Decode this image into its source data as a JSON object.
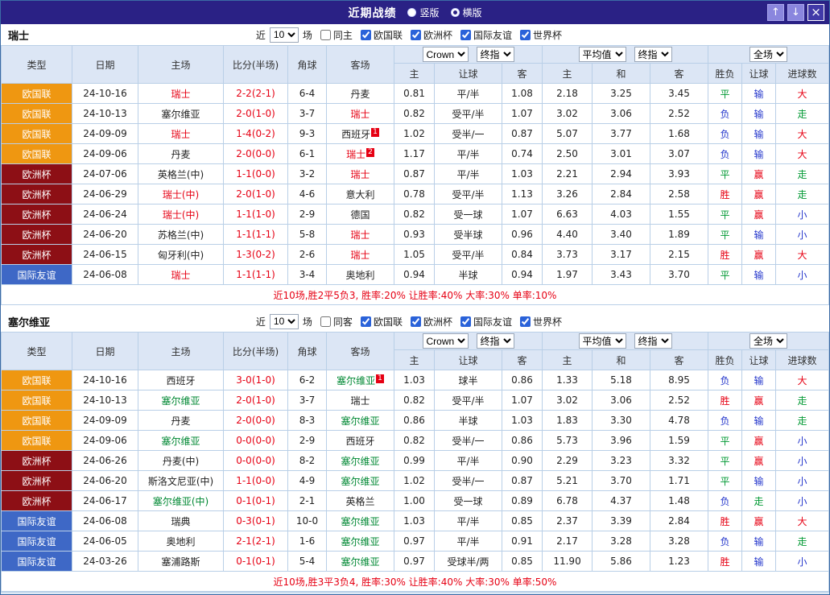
{
  "palette": {
    "titlebar_bg": "#2a2185",
    "type_bg": {
      "欧国联": "#ef9711",
      "欧洲杯": "#8d0f15",
      "国际友谊": "#3e68c6"
    },
    "result": {
      "red": "#e60013",
      "green": "#009933",
      "blue": "#2335cb"
    },
    "team": {
      "red": "#e60013",
      "green": "#008833",
      "black": "#222222"
    },
    "score": "#e60013"
  },
  "titlebar": {
    "title": "近期战绩",
    "radios": [
      {
        "label": "竖版",
        "selected": false
      },
      {
        "label": "横版",
        "selected": true
      }
    ],
    "buttons": [
      {
        "name": "scroll-up",
        "glyph": "↑"
      },
      {
        "name": "scroll-down",
        "glyph": "↓"
      },
      {
        "name": "close",
        "glyph": "×"
      }
    ]
  },
  "filter": {
    "recent_prefix": "近",
    "recent_value": "10",
    "recent_suffix": "场",
    "leagues": [
      {
        "label": "欧国联",
        "checked": true
      },
      {
        "label": "欧洲杯",
        "checked": true
      },
      {
        "label": "国际友谊",
        "checked": true
      },
      {
        "label": "世界杯",
        "checked": true
      }
    ]
  },
  "table": {
    "columns": [
      "类型",
      "日期",
      "主场",
      "比分(半场)",
      "角球",
      "客场",
      "主",
      "让球",
      "客",
      "主",
      "和",
      "客",
      "胜负",
      "让球",
      "进球数"
    ],
    "selects": {
      "odds_source": "Crown",
      "odds_stage": "终指",
      "avg_source": "平均值",
      "avg_stage": "终指",
      "scope": "全场"
    }
  },
  "sections": [
    {
      "team": "瑞士",
      "same_side_label": "同主",
      "same_side_checked": false,
      "summary": "近10场,胜2平5负3, 胜率:20% 让胜率:40% 大率:30% 单率:10%",
      "rows": [
        {
          "type": "欧国联",
          "date": "24-10-16",
          "home": {
            "name": "瑞士",
            "color": "red"
          },
          "score": "2-2(2-1)",
          "corner": "6-4",
          "away": {
            "name": "丹麦",
            "color": "black"
          },
          "odds": [
            "0.81",
            "平/半",
            "1.08"
          ],
          "avg": [
            "2.18",
            "3.25",
            "3.45"
          ],
          "results": [
            {
              "text": "平",
              "color": "green"
            },
            {
              "text": "输",
              "color": "blue"
            },
            {
              "text": "大",
              "color": "red"
            }
          ]
        },
        {
          "type": "欧国联",
          "date": "24-10-13",
          "home": {
            "name": "塞尔维亚",
            "color": "black"
          },
          "score": "2-0(1-0)",
          "corner": "3-7",
          "away": {
            "name": "瑞士",
            "color": "red"
          },
          "odds": [
            "0.82",
            "受平/半",
            "1.07"
          ],
          "avg": [
            "3.02",
            "3.06",
            "2.52"
          ],
          "results": [
            {
              "text": "负",
              "color": "blue"
            },
            {
              "text": "输",
              "color": "blue"
            },
            {
              "text": "走",
              "color": "green"
            }
          ]
        },
        {
          "type": "欧国联",
          "date": "24-09-09",
          "home": {
            "name": "瑞士",
            "color": "red"
          },
          "score": "1-4(0-2)",
          "corner": "9-3",
          "away": {
            "name": "西班牙",
            "color": "black",
            "badge": "1"
          },
          "odds": [
            "1.02",
            "受半/一",
            "0.87"
          ],
          "avg": [
            "5.07",
            "3.77",
            "1.68"
          ],
          "results": [
            {
              "text": "负",
              "color": "blue"
            },
            {
              "text": "输",
              "color": "blue"
            },
            {
              "text": "大",
              "color": "red"
            }
          ]
        },
        {
          "type": "欧国联",
          "date": "24-09-06",
          "home": {
            "name": "丹麦",
            "color": "black"
          },
          "score": "2-0(0-0)",
          "corner": "6-1",
          "away": {
            "name": "瑞士",
            "color": "red",
            "badge": "2"
          },
          "odds": [
            "1.17",
            "平/半",
            "0.74"
          ],
          "avg": [
            "2.50",
            "3.01",
            "3.07"
          ],
          "results": [
            {
              "text": "负",
              "color": "blue"
            },
            {
              "text": "输",
              "color": "blue"
            },
            {
              "text": "大",
              "color": "red"
            }
          ]
        },
        {
          "type": "欧洲杯",
          "date": "24-07-06",
          "home": {
            "name": "英格兰(中)",
            "color": "black"
          },
          "score": "1-1(0-0)",
          "corner": "3-2",
          "away": {
            "name": "瑞士",
            "color": "red"
          },
          "odds": [
            "0.87",
            "平/半",
            "1.03"
          ],
          "avg": [
            "2.21",
            "2.94",
            "3.93"
          ],
          "results": [
            {
              "text": "平",
              "color": "green"
            },
            {
              "text": "赢",
              "color": "red"
            },
            {
              "text": "走",
              "color": "green"
            }
          ]
        },
        {
          "type": "欧洲杯",
          "date": "24-06-29",
          "home": {
            "name": "瑞士(中)",
            "color": "red"
          },
          "score": "2-0(1-0)",
          "corner": "4-6",
          "away": {
            "name": "意大利",
            "color": "black"
          },
          "odds": [
            "0.78",
            "受平/半",
            "1.13"
          ],
          "avg": [
            "3.26",
            "2.84",
            "2.58"
          ],
          "results": [
            {
              "text": "胜",
              "color": "red"
            },
            {
              "text": "赢",
              "color": "red"
            },
            {
              "text": "走",
              "color": "green"
            }
          ]
        },
        {
          "type": "欧洲杯",
          "date": "24-06-24",
          "home": {
            "name": "瑞士(中)",
            "color": "red"
          },
          "score": "1-1(1-0)",
          "corner": "2-9",
          "away": {
            "name": "德国",
            "color": "black"
          },
          "odds": [
            "0.82",
            "受一球",
            "1.07"
          ],
          "avg": [
            "6.63",
            "4.03",
            "1.55"
          ],
          "results": [
            {
              "text": "平",
              "color": "green"
            },
            {
              "text": "赢",
              "color": "red"
            },
            {
              "text": "小",
              "color": "blue"
            }
          ]
        },
        {
          "type": "欧洲杯",
          "date": "24-06-20",
          "home": {
            "name": "苏格兰(中)",
            "color": "black"
          },
          "score": "1-1(1-1)",
          "corner": "5-8",
          "away": {
            "name": "瑞士",
            "color": "red"
          },
          "odds": [
            "0.93",
            "受半球",
            "0.96"
          ],
          "avg": [
            "4.40",
            "3.40",
            "1.89"
          ],
          "results": [
            {
              "text": "平",
              "color": "green"
            },
            {
              "text": "输",
              "color": "blue"
            },
            {
              "text": "小",
              "color": "blue"
            }
          ]
        },
        {
          "type": "欧洲杯",
          "date": "24-06-15",
          "home": {
            "name": "匈牙利(中)",
            "color": "black"
          },
          "score": "1-3(0-2)",
          "corner": "2-6",
          "away": {
            "name": "瑞士",
            "color": "red"
          },
          "odds": [
            "1.05",
            "受平/半",
            "0.84"
          ],
          "avg": [
            "3.73",
            "3.17",
            "2.15"
          ],
          "results": [
            {
              "text": "胜",
              "color": "red"
            },
            {
              "text": "赢",
              "color": "red"
            },
            {
              "text": "大",
              "color": "red"
            }
          ]
        },
        {
          "type": "国际友谊",
          "date": "24-06-08",
          "home": {
            "name": "瑞士",
            "color": "red"
          },
          "score": "1-1(1-1)",
          "corner": "3-4",
          "away": {
            "name": "奥地利",
            "color": "black"
          },
          "odds": [
            "0.94",
            "半球",
            "0.94"
          ],
          "avg": [
            "1.97",
            "3.43",
            "3.70"
          ],
          "results": [
            {
              "text": "平",
              "color": "green"
            },
            {
              "text": "输",
              "color": "blue"
            },
            {
              "text": "小",
              "color": "blue"
            }
          ]
        }
      ]
    },
    {
      "team": "塞尔维亚",
      "same_side_label": "同客",
      "same_side_checked": false,
      "summary": "近10场,胜3平3负4, 胜率:30% 让胜率:40% 大率:30% 单率:50%",
      "rows": [
        {
          "type": "欧国联",
          "date": "24-10-16",
          "home": {
            "name": "西班牙",
            "color": "black"
          },
          "score": "3-0(1-0)",
          "corner": "6-2",
          "away": {
            "name": "塞尔维亚",
            "color": "green",
            "badge": "1"
          },
          "odds": [
            "1.03",
            "球半",
            "0.86"
          ],
          "avg": [
            "1.33",
            "5.18",
            "8.95"
          ],
          "results": [
            {
              "text": "负",
              "color": "blue"
            },
            {
              "text": "输",
              "color": "blue"
            },
            {
              "text": "大",
              "color": "red"
            }
          ]
        },
        {
          "type": "欧国联",
          "date": "24-10-13",
          "home": {
            "name": "塞尔维亚",
            "color": "green"
          },
          "score": "2-0(1-0)",
          "corner": "3-7",
          "away": {
            "name": "瑞士",
            "color": "black"
          },
          "odds": [
            "0.82",
            "受平/半",
            "1.07"
          ],
          "avg": [
            "3.02",
            "3.06",
            "2.52"
          ],
          "results": [
            {
              "text": "胜",
              "color": "red"
            },
            {
              "text": "赢",
              "color": "red"
            },
            {
              "text": "走",
              "color": "green"
            }
          ]
        },
        {
          "type": "欧国联",
          "date": "24-09-09",
          "home": {
            "name": "丹麦",
            "color": "black"
          },
          "score": "2-0(0-0)",
          "corner": "8-3",
          "away": {
            "name": "塞尔维亚",
            "color": "green"
          },
          "odds": [
            "0.86",
            "半球",
            "1.03"
          ],
          "avg": [
            "1.83",
            "3.30",
            "4.78"
          ],
          "results": [
            {
              "text": "负",
              "color": "blue"
            },
            {
              "text": "输",
              "color": "blue"
            },
            {
              "text": "走",
              "color": "green"
            }
          ]
        },
        {
          "type": "欧国联",
          "date": "24-09-06",
          "home": {
            "name": "塞尔维亚",
            "color": "green"
          },
          "score": "0-0(0-0)",
          "corner": "2-9",
          "away": {
            "name": "西班牙",
            "color": "black"
          },
          "odds": [
            "0.82",
            "受半/一",
            "0.86"
          ],
          "avg": [
            "5.73",
            "3.96",
            "1.59"
          ],
          "results": [
            {
              "text": "平",
              "color": "green"
            },
            {
              "text": "赢",
              "color": "red"
            },
            {
              "text": "小",
              "color": "blue"
            }
          ]
        },
        {
          "type": "欧洲杯",
          "date": "24-06-26",
          "home": {
            "name": "丹麦(中)",
            "color": "black"
          },
          "score": "0-0(0-0)",
          "corner": "8-2",
          "away": {
            "name": "塞尔维亚",
            "color": "green"
          },
          "odds": [
            "0.99",
            "平/半",
            "0.90"
          ],
          "avg": [
            "2.29",
            "3.23",
            "3.32"
          ],
          "results": [
            {
              "text": "平",
              "color": "green"
            },
            {
              "text": "赢",
              "color": "red"
            },
            {
              "text": "小",
              "color": "blue"
            }
          ]
        },
        {
          "type": "欧洲杯",
          "date": "24-06-20",
          "home": {
            "name": "斯洛文尼亚(中)",
            "color": "black"
          },
          "score": "1-1(0-0)",
          "corner": "4-9",
          "away": {
            "name": "塞尔维亚",
            "color": "green"
          },
          "odds": [
            "1.02",
            "受半/一",
            "0.87"
          ],
          "avg": [
            "5.21",
            "3.70",
            "1.71"
          ],
          "results": [
            {
              "text": "平",
              "color": "green"
            },
            {
              "text": "输",
              "color": "blue"
            },
            {
              "text": "小",
              "color": "blue"
            }
          ]
        },
        {
          "type": "欧洲杯",
          "date": "24-06-17",
          "home": {
            "name": "塞尔维亚(中)",
            "color": "green"
          },
          "score": "0-1(0-1)",
          "corner": "2-1",
          "away": {
            "name": "英格兰",
            "color": "black"
          },
          "odds": [
            "1.00",
            "受一球",
            "0.89"
          ],
          "avg": [
            "6.78",
            "4.37",
            "1.48"
          ],
          "results": [
            {
              "text": "负",
              "color": "blue"
            },
            {
              "text": "走",
              "color": "green"
            },
            {
              "text": "小",
              "color": "blue"
            }
          ]
        },
        {
          "type": "国际友谊",
          "date": "24-06-08",
          "home": {
            "name": "瑞典",
            "color": "black"
          },
          "score": "0-3(0-1)",
          "corner": "10-0",
          "away": {
            "name": "塞尔维亚",
            "color": "green"
          },
          "odds": [
            "1.03",
            "平/半",
            "0.85"
          ],
          "avg": [
            "2.37",
            "3.39",
            "2.84"
          ],
          "results": [
            {
              "text": "胜",
              "color": "red"
            },
            {
              "text": "赢",
              "color": "red"
            },
            {
              "text": "大",
              "color": "red"
            }
          ]
        },
        {
          "type": "国际友谊",
          "date": "24-06-05",
          "home": {
            "name": "奥地利",
            "color": "black"
          },
          "score": "2-1(2-1)",
          "corner": "1-6",
          "away": {
            "name": "塞尔维亚",
            "color": "green"
          },
          "odds": [
            "0.97",
            "平/半",
            "0.91"
          ],
          "avg": [
            "2.17",
            "3.28",
            "3.28"
          ],
          "results": [
            {
              "text": "负",
              "color": "blue"
            },
            {
              "text": "输",
              "color": "blue"
            },
            {
              "text": "走",
              "color": "green"
            }
          ]
        },
        {
          "type": "国际友谊",
          "date": "24-03-26",
          "home": {
            "name": "塞浦路斯",
            "color": "black"
          },
          "score": "0-1(0-1)",
          "corner": "5-4",
          "away": {
            "name": "塞尔维亚",
            "color": "green"
          },
          "odds": [
            "0.97",
            "受球半/两",
            "0.85"
          ],
          "avg": [
            "11.90",
            "5.86",
            "1.23"
          ],
          "results": [
            {
              "text": "胜",
              "color": "red"
            },
            {
              "text": "输",
              "color": "blue"
            },
            {
              "text": "小",
              "color": "blue"
            }
          ]
        }
      ]
    }
  ]
}
